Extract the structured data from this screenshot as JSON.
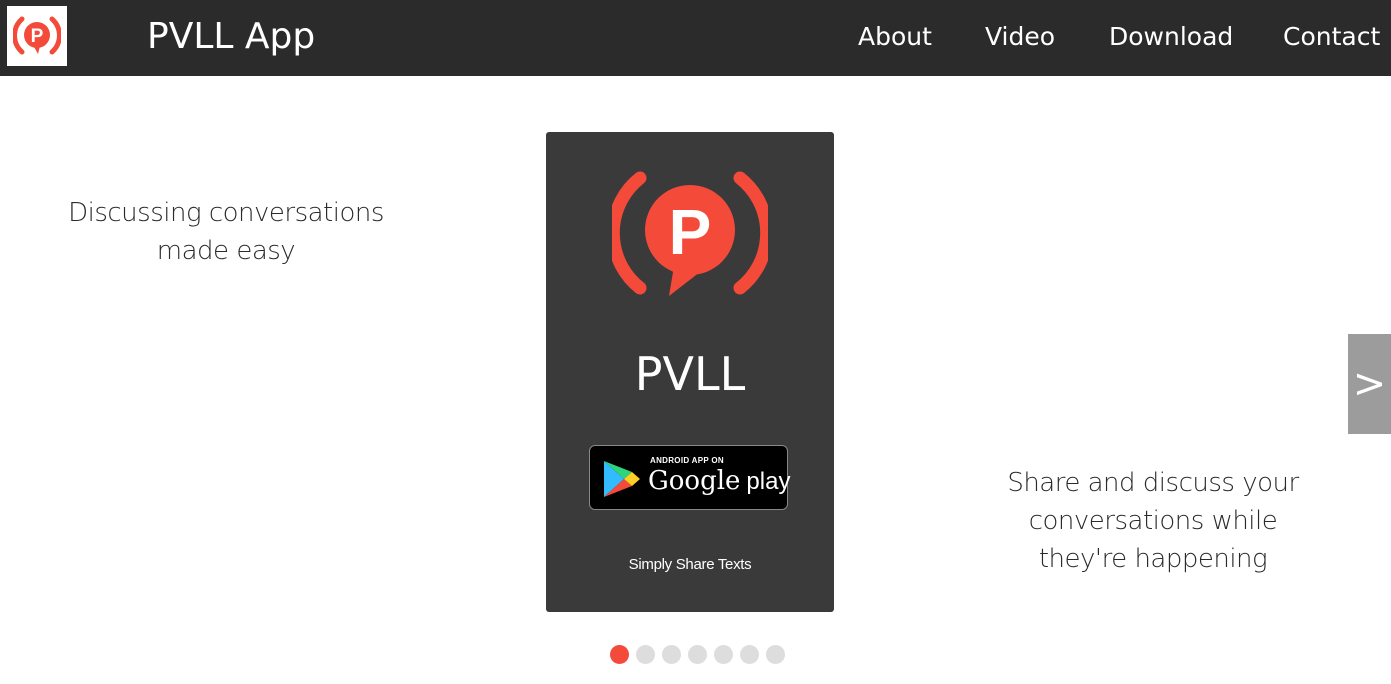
{
  "header": {
    "brand": "PVLL App",
    "nav": [
      {
        "label": "About"
      },
      {
        "label": "Video"
      },
      {
        "label": "Download"
      },
      {
        "label": "Contact"
      }
    ]
  },
  "slider": {
    "tagline_left": "Discussing conversations made easy",
    "tagline_right": "Share and discuss your conversations while they're happening",
    "card": {
      "title": "PVLL",
      "store_badge_small": "ANDROID APP ON",
      "store_badge_google": "Google",
      "store_badge_play": "play",
      "subtitle": "Simply Share Texts"
    },
    "next_label": ">",
    "dots_total": 7,
    "active_dot": 1
  },
  "colors": {
    "navbar": "#2b2b2b",
    "brand_red": "#f44a3a",
    "card_bg": "#3a3a3a",
    "next_button": "#9c9c9c",
    "dot_inactive": "#dddddd"
  },
  "icons": {
    "logo": "pvll-logo-icon",
    "store": "google-play-icon"
  }
}
